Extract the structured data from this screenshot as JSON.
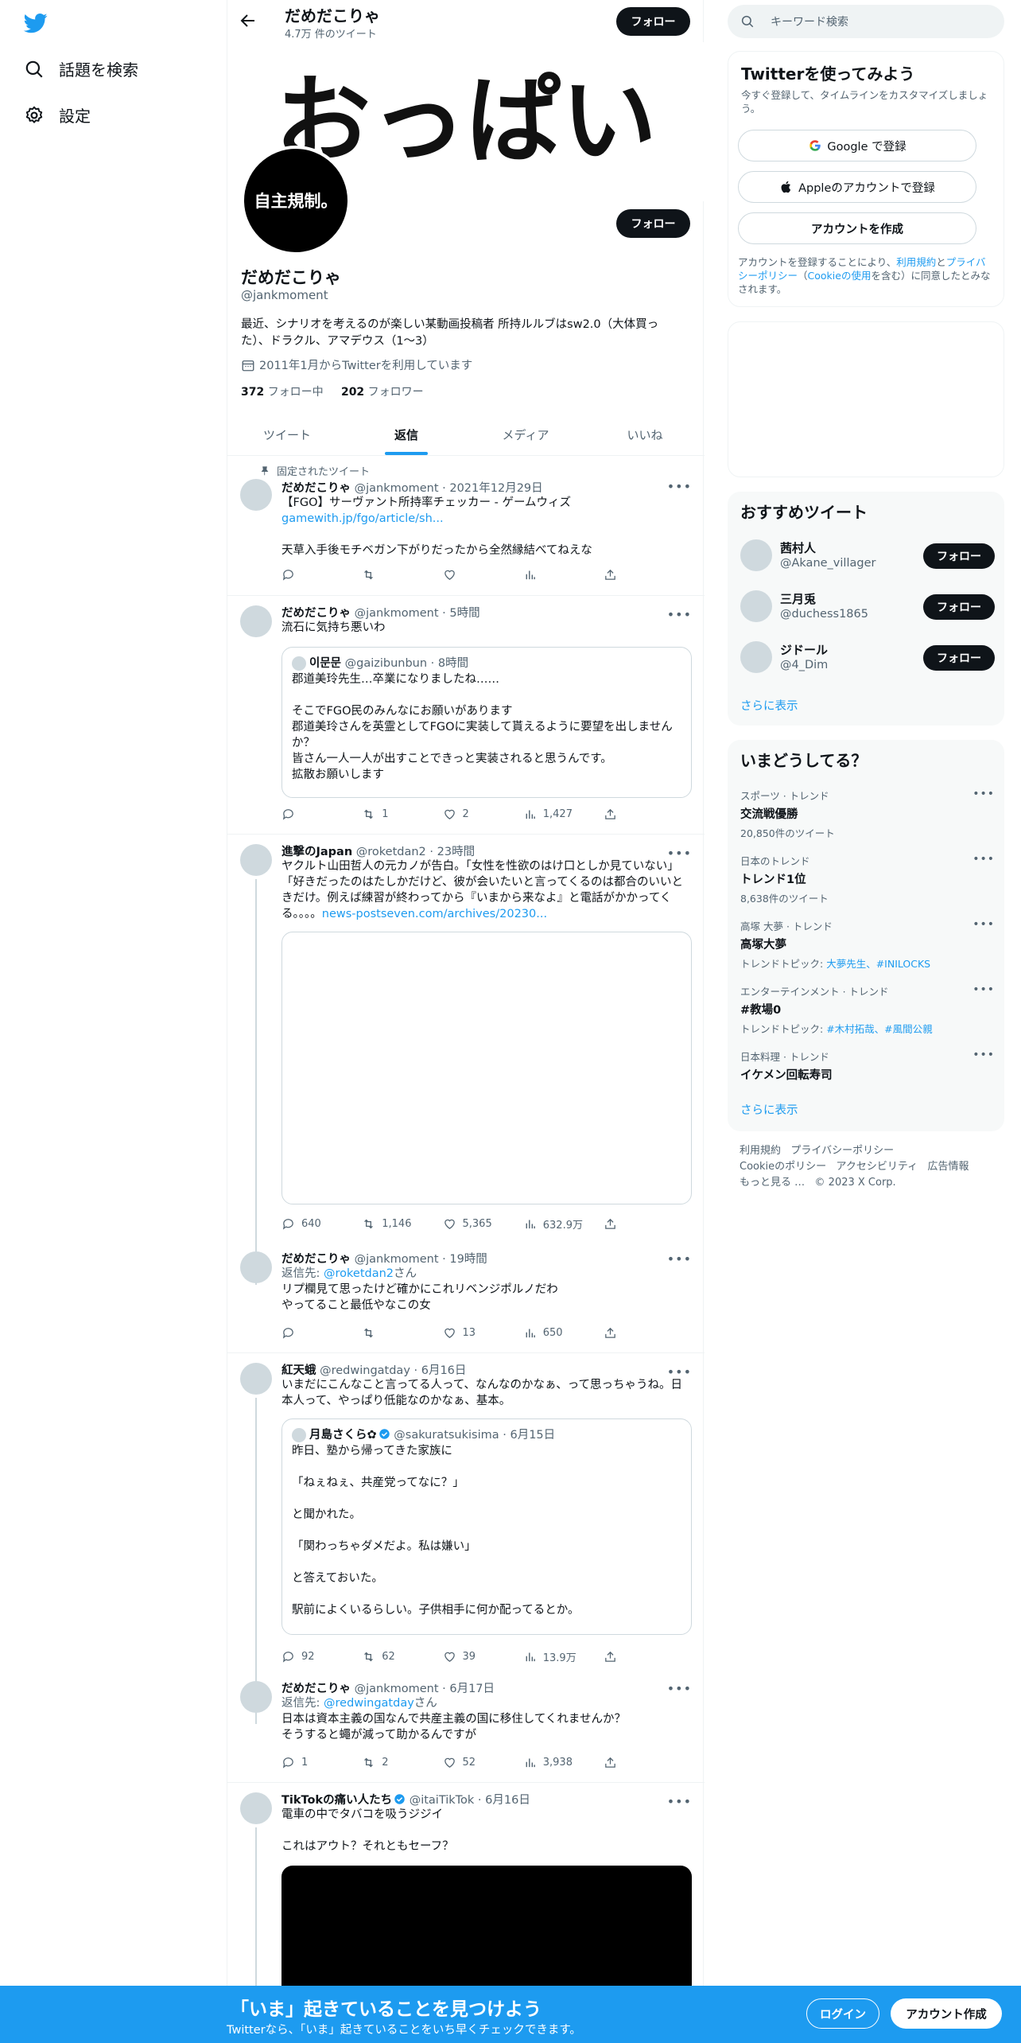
{
  "nav": {
    "explore": "話題を検索",
    "settings": "設定"
  },
  "header": {
    "name": "だめだこりゃ",
    "tweet_count": "4.7万 件のツイート",
    "follow": "フォロー"
  },
  "banner": {
    "text": "おっぱい"
  },
  "profile": {
    "avatar_text": "自主規制。",
    "name": "だめだこりゃ",
    "handle": "@jankmoment",
    "bio": "最近、シナリオを考えるのが楽しい某動画投稿者 所持ルルブはsw2.0（大体買った）、ドラクル、アマデウス（1〜3）",
    "joined": "2011年1月からTwitterを利用しています",
    "following_count": "372",
    "following_label": "フォロー中",
    "followers_count": "202",
    "followers_label": "フォロワー",
    "follow": "フォロー"
  },
  "tabs": [
    "ツイート",
    "返信",
    "メディア",
    "いいね"
  ],
  "tweets": [
    {
      "pinned": "固定されたツイート",
      "name": "だめだこりゃ",
      "meta": "@jankmoment · 2021年12月29日",
      "text": "【FGO】サーヴァント所持率チェッカー - ゲームウィズ",
      "link": "gamewith.jp/fgo/article/sh...",
      "text2": "天草入手後モチベガン下がりだったから全然縁結べてねえな",
      "actions": [
        "",
        "",
        "",
        ""
      ]
    },
    {
      "name": "だめだこりゃ",
      "meta": "@jankmoment · 5時間",
      "text": "流石に気持ち悪いわ",
      "quote": {
        "name": "이문문",
        "meta": "@gaizibunbun · 8時間",
        "text": "郡道美玲先生…卒業になりましたね……\n\nそこでFGO民のみんなにお願いがあります\n郡道美玲さんを英霊としてFGOに実装して貰えるように要望を出しませんか？\n皆さん一人一人が出すことできっと実装されると思うんです。\n拡散お願いします"
      },
      "actions": [
        "",
        "1",
        "2",
        "1,427"
      ]
    },
    {
      "name": "進撃のJapan",
      "meta": "@roketdan2 · 23時間",
      "text": "ヤクルト山田哲人の元カノが告白。「女性を性欲のはけ口としか見ていない」「好きだったのはたしかだけど、彼が会いたいと言ってくるのは都合のいいときだけ。例えば練習が終わってから『いまから来なよ』と電話がかかってくる。。。。",
      "link": "news-postseven.com/archives/20230...",
      "actions": [
        "640",
        "1,146",
        "5,365",
        "632.9万"
      ]
    },
    {
      "name": "だめだこりゃ",
      "meta": "@jankmoment · 19時間",
      "reply_prefix": "返信先: ",
      "reply_to": "@roketdan2",
      "reply_suffix": "さん",
      "text": "リプ欄見て思ったけど確かにこれリベンジポルノだわ\nやってること最低やなこの女",
      "actions": [
        "",
        "",
        "13",
        "650"
      ]
    },
    {
      "name": "紅天蛾",
      "meta": "@redwingatday · 6月16日",
      "text": "いまだにこんなこと言ってる人って、なんなのかなぁ、って思っちゃうね。日本人って、やっぱり低能なのかなぁ、基本。",
      "quote": {
        "name": "月島さくら✿",
        "meta": "@sakuratsukisima · 6月15日",
        "text": "昨日、塾から帰ってきた家族に\n\n「ねぇねぇ、共産党ってなに？」\n\nと聞かれた。\n\n「関わっちゃダメだよ。私は嫌い」\n\nと答えておいた。\n\n駅前によくいるらしい。子供相手に何か配ってるとか。"
      },
      "actions": [
        "92",
        "62",
        "39",
        "13.9万"
      ]
    },
    {
      "name": "だめだこりゃ",
      "meta": "@jankmoment · 6月17日",
      "reply_prefix": "返信先: ",
      "reply_to": "@redwingatday",
      "reply_suffix": "さん",
      "text": "日本は資本主義の国なんで共産主義の国に移住してくれませんか？\nそうすると蠅が減って助かるんですが",
      "actions": [
        "1",
        "2",
        "52",
        "3,938"
      ]
    },
    {
      "name": "TikTokの痛い人たち",
      "meta": "@itaiTikTok · 6月16日",
      "text": "電車の中でタバコを吸うジジイ\n\nこれはアウト？それともセーフ？"
    }
  ],
  "right": {
    "search_placeholder": "キーワード検索",
    "signup": {
      "title": "Twitterを使ってみよう",
      "subtitle": "今すぐ登録して、タイムラインをカスタマイズしましょう。",
      "google": "Google で登録",
      "apple": "Appleのアカウントで登録",
      "create": "アカウントを作成",
      "terms_1": "アカウントを登録することにより、",
      "terms_link1": "利用規約",
      "terms_2": "と",
      "terms_link2": "プライバシーポリシー",
      "terms_3": "（",
      "terms_link3": "Cookieの使用",
      "terms_4": "を含む）に同意したとみなされます。"
    },
    "wtf": {
      "title": "おすすめツイート",
      "users": [
        {
          "name": "茜村人",
          "handle": "@Akane_villager"
        },
        {
          "name": "三月兎",
          "handle": "@duchess1865"
        },
        {
          "name": "ジドール",
          "handle": "@4_Dim"
        }
      ],
      "follow": "フォロー",
      "more": "さらに表示"
    },
    "trends": {
      "title": "いまどうしてる？",
      "items": [
        {
          "cat": "スポーツ · トレンド",
          "name": "交流戦優勝",
          "sub": "20,850件のツイート"
        },
        {
          "cat": "日本のトレンド",
          "name": "トレンド1位",
          "sub": "8,638件のツイート"
        },
        {
          "cat": "高塚 大夢 · トレンド",
          "name": "高塚大夢",
          "sub_prefix": "トレンドトピック: ",
          "sub_links": "大夢先生、#INILOCKS"
        },
        {
          "cat": "エンターテインメント · トレンド",
          "name": "#教場0",
          "sub_prefix": "トレンドトピック: ",
          "sub_links": "#木村拓哉、#風間公親"
        },
        {
          "cat": "日本料理 · トレンド",
          "name": "イケメン回転寿司"
        }
      ],
      "more": "さらに表示"
    },
    "footer": {
      "l1": "利用規約",
      "l2": "プライバシーポリシー",
      "l3": "Cookieのポリシー",
      "l4": "アクセシビリティ",
      "l5": "広告情報",
      "l6": "もっと見る …",
      "copy": "© 2023 X Corp."
    }
  },
  "bottombar": {
    "title": "「いま」起きていることを見つけよう",
    "subtitle": "Twitterなら、「いま」起きていることをいち早くチェックできます。",
    "login": "ログイン",
    "signup": "アカウント作成"
  },
  "colors": {
    "accent": "#1d9bf0",
    "text": "#0f1419",
    "secondary": "#536471"
  }
}
